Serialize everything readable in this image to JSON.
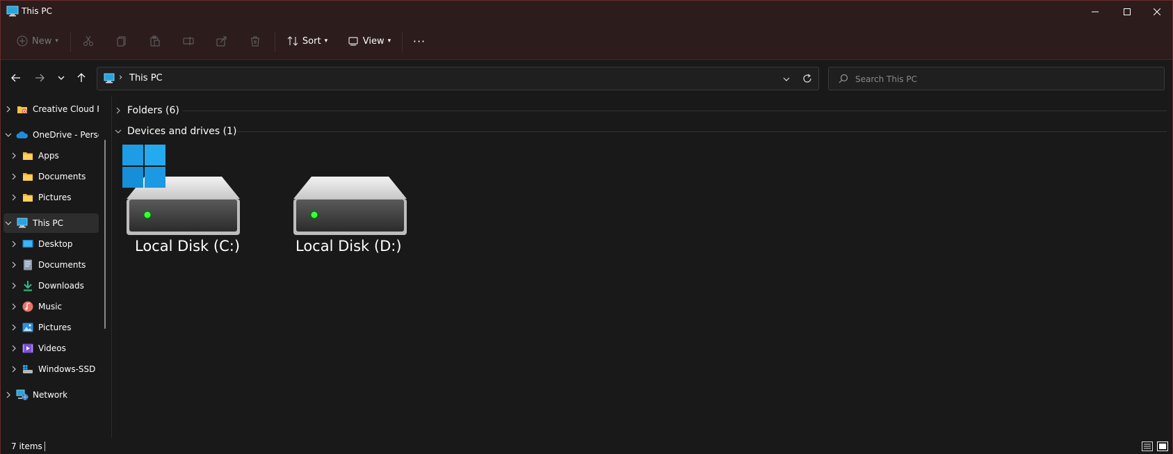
{
  "window": {
    "title": "This PC",
    "accent": "#2d1c1c",
    "icon": "this-pc-icon"
  },
  "toolbar": {
    "new_label": "New",
    "sort_label": "Sort",
    "view_label": "View",
    "more_label": "···"
  },
  "address": {
    "path": "This PC",
    "search_placeholder": "Search This PC"
  },
  "sidebar": {
    "items": [
      {
        "label": "Creative Cloud Fi",
        "icon": "creative-cloud-icon",
        "expanded": false
      },
      {
        "label": "OneDrive - Perso",
        "icon": "onedrive-icon",
        "expanded": true
      },
      {
        "label": "Apps",
        "icon": "folder-icon",
        "expanded": false
      },
      {
        "label": "Documents",
        "icon": "folder-icon",
        "expanded": false
      },
      {
        "label": "Pictures",
        "icon": "folder-icon",
        "expanded": false
      },
      {
        "label": "This PC",
        "icon": "this-pc-icon",
        "expanded": true,
        "selected": true
      },
      {
        "label": "Desktop",
        "icon": "desktop-icon",
        "expanded": false
      },
      {
        "label": "Documents",
        "icon": "documents-icon",
        "expanded": false
      },
      {
        "label": "Downloads",
        "icon": "downloads-icon",
        "expanded": false
      },
      {
        "label": "Music",
        "icon": "music-icon",
        "expanded": false
      },
      {
        "label": "Pictures",
        "icon": "pictures-icon",
        "expanded": false
      },
      {
        "label": "Videos",
        "icon": "videos-icon",
        "expanded": false
      },
      {
        "label": "Windows-SSD (",
        "icon": "drive-icon",
        "expanded": false
      },
      {
        "label": "Network",
        "icon": "network-icon",
        "expanded": false
      }
    ]
  },
  "content": {
    "groups": [
      {
        "label": "Folders (6)",
        "expanded": false
      },
      {
        "label": "Devices and drives (1)",
        "expanded": true
      }
    ],
    "drives": [
      {
        "label": "Local Disk (C:)",
        "system": true
      },
      {
        "label": "Local Disk (D:)",
        "system": false
      }
    ]
  },
  "status": {
    "items": "7 items"
  }
}
